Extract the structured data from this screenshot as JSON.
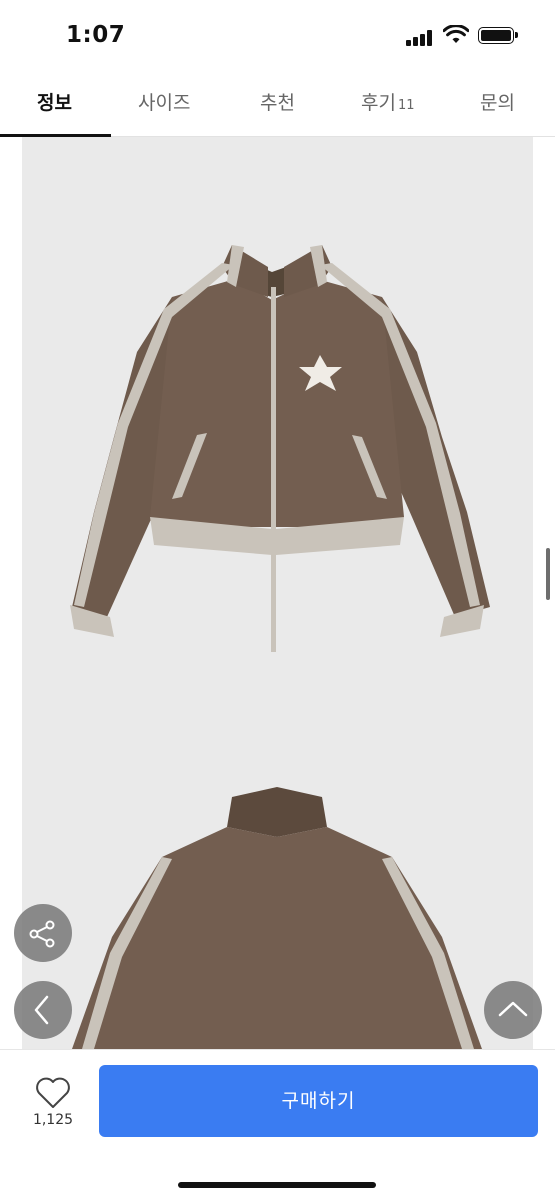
{
  "status_bar": {
    "time": "1:07"
  },
  "tabs": [
    {
      "label": "정보",
      "active": true
    },
    {
      "label": "사이즈",
      "active": false
    },
    {
      "label": "추천",
      "active": false
    },
    {
      "label": "후기",
      "count": "11",
      "active": false
    },
    {
      "label": "문의",
      "active": false
    }
  ],
  "floating_buttons": {
    "share_icon": "share-icon",
    "back_icon": "chevron-left-icon",
    "top_icon": "chevron-up-icon"
  },
  "bottom_bar": {
    "like_count": "1,125",
    "buy_label": "구매하기"
  },
  "colors": {
    "accent": "#3a7cf2",
    "image_bg": "#eaeaea",
    "jacket": "#6e5a4c",
    "stripe": "#c9c3ba"
  }
}
